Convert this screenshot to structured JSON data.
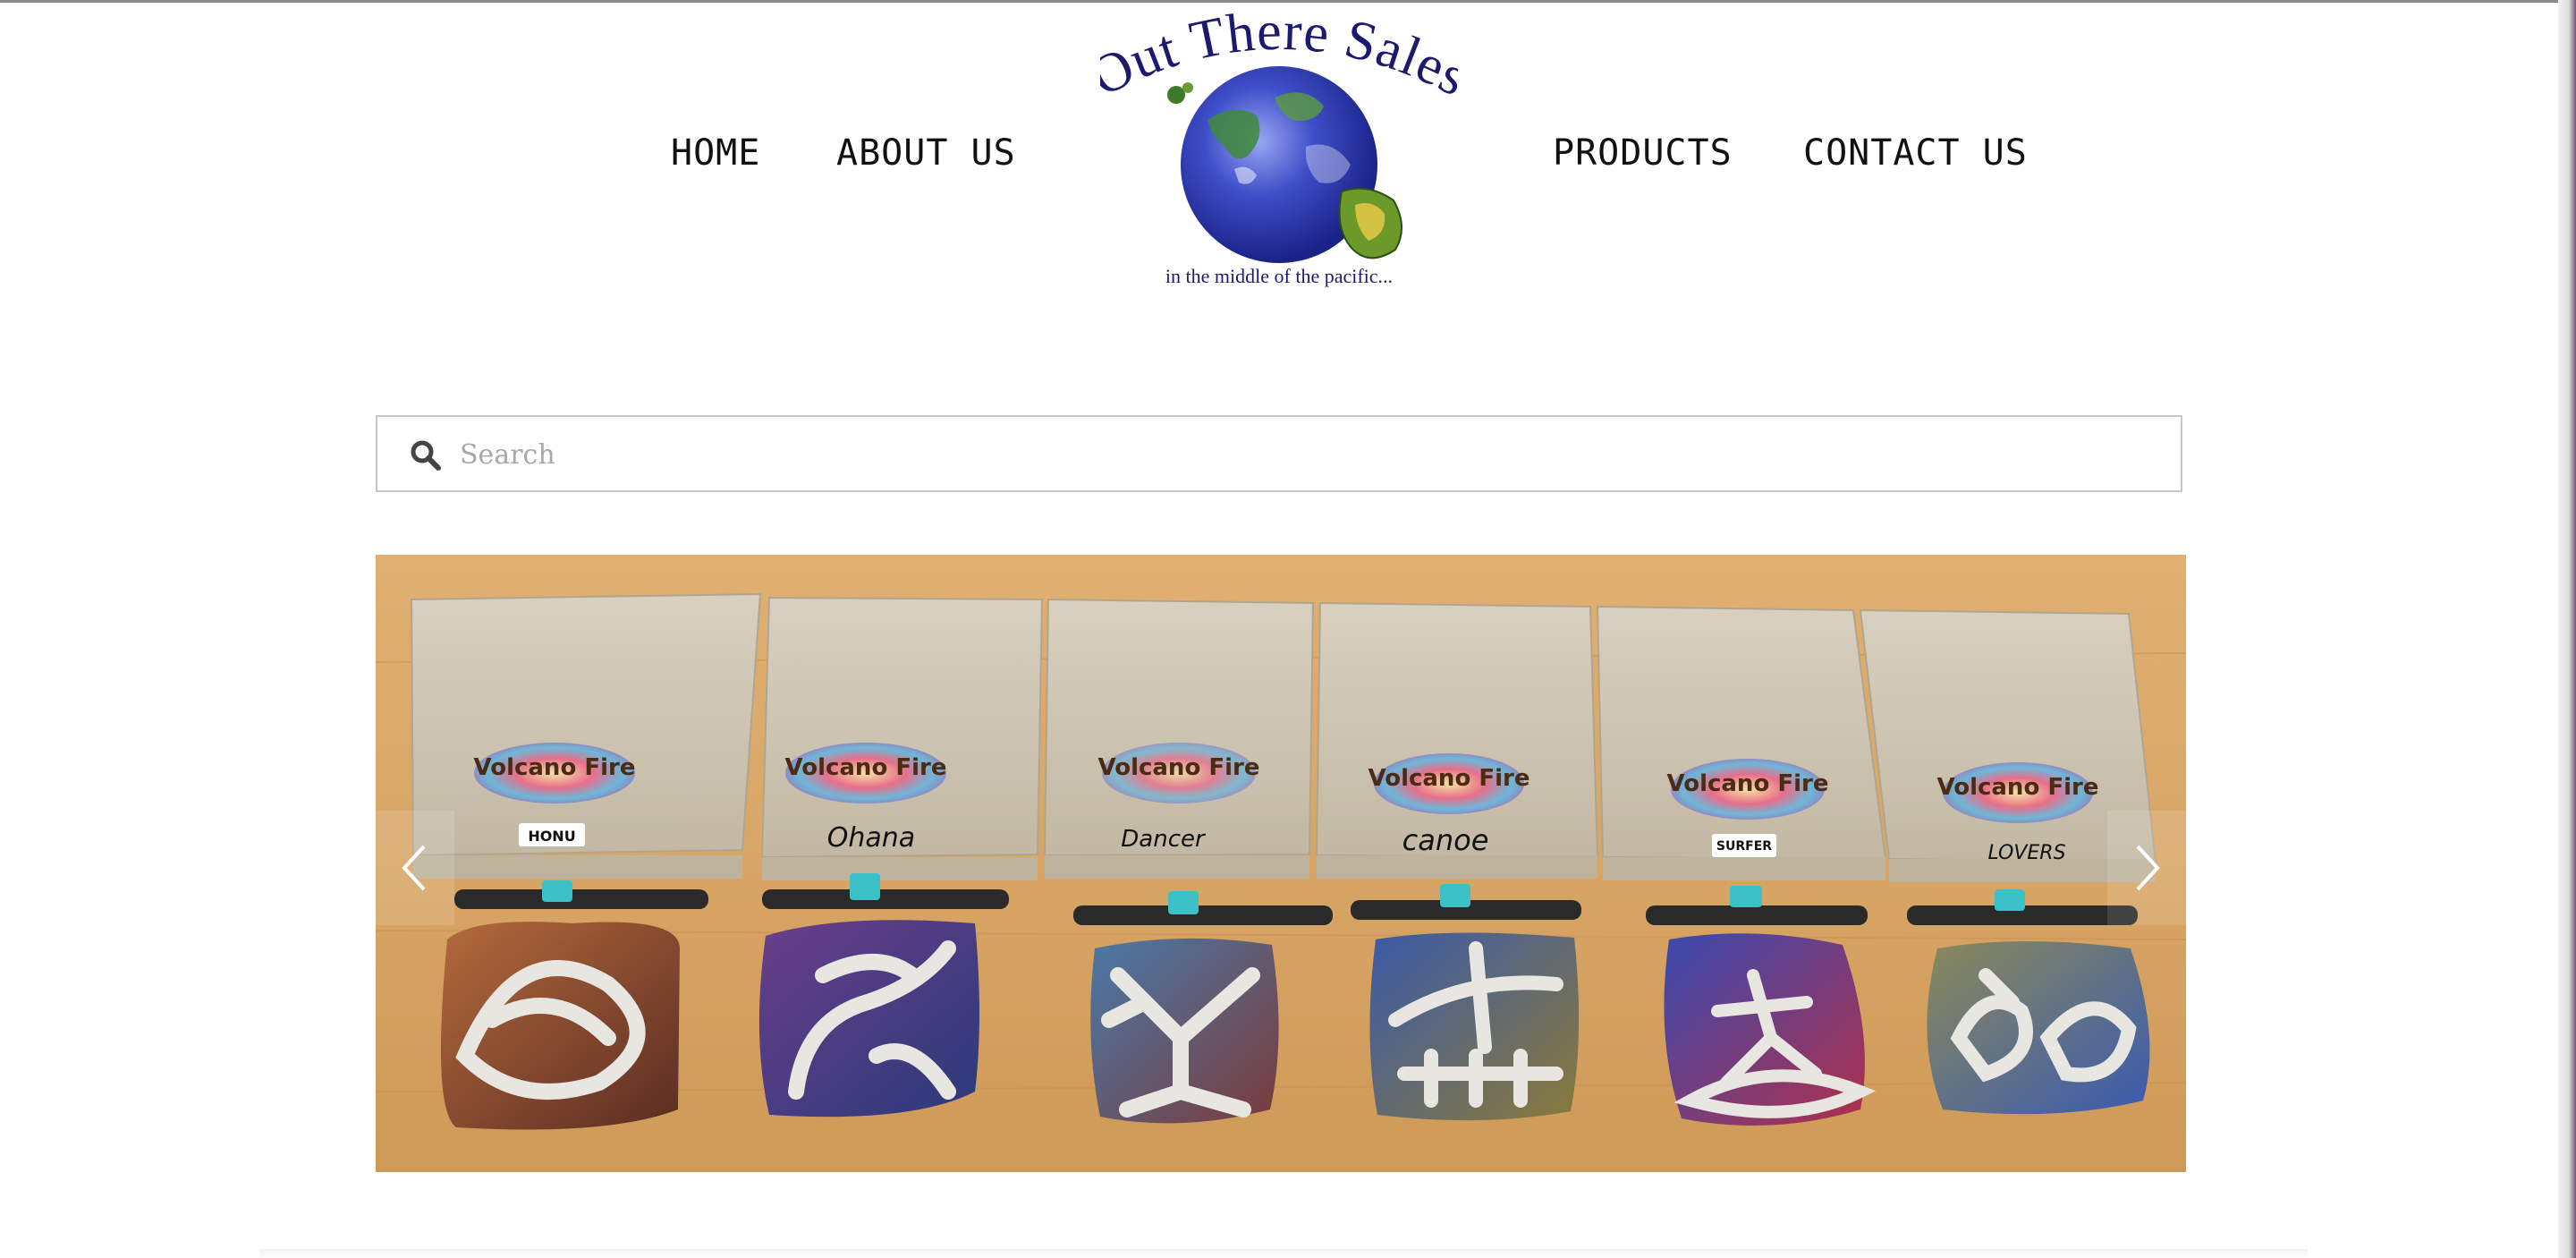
{
  "nav": {
    "home": "HOME",
    "about": "ABOUT US",
    "products": "PRODUCTS",
    "contact": "CONTACT US"
  },
  "logo": {
    "title": "Out There Sales",
    "tagline": "in the middle of the pacific..."
  },
  "search": {
    "placeholder": "Search",
    "icon": "search-icon"
  },
  "slider": {
    "prev_icon": "chevron-left-icon",
    "next_icon": "chevron-right-icon",
    "products": [
      {
        "box_label": "HONU",
        "sticker": "Volcano Fire"
      },
      {
        "box_label": "Ohana",
        "sticker": "Volcano Fire"
      },
      {
        "box_label": "Dancer",
        "sticker": "Volcano Fire"
      },
      {
        "box_label": "canoe",
        "sticker": "Volcano Fire"
      },
      {
        "box_label": "SURFER",
        "sticker": "Volcano Fire"
      },
      {
        "box_label": "LOVERS",
        "sticker": "Volcano Fire"
      }
    ]
  },
  "colors": {
    "nav_text": "#111111",
    "logo_blue": "#1c1a6e",
    "wood": "#d9a865",
    "box": "#cfc5b3",
    "turquoise": "#3cc1c8"
  }
}
